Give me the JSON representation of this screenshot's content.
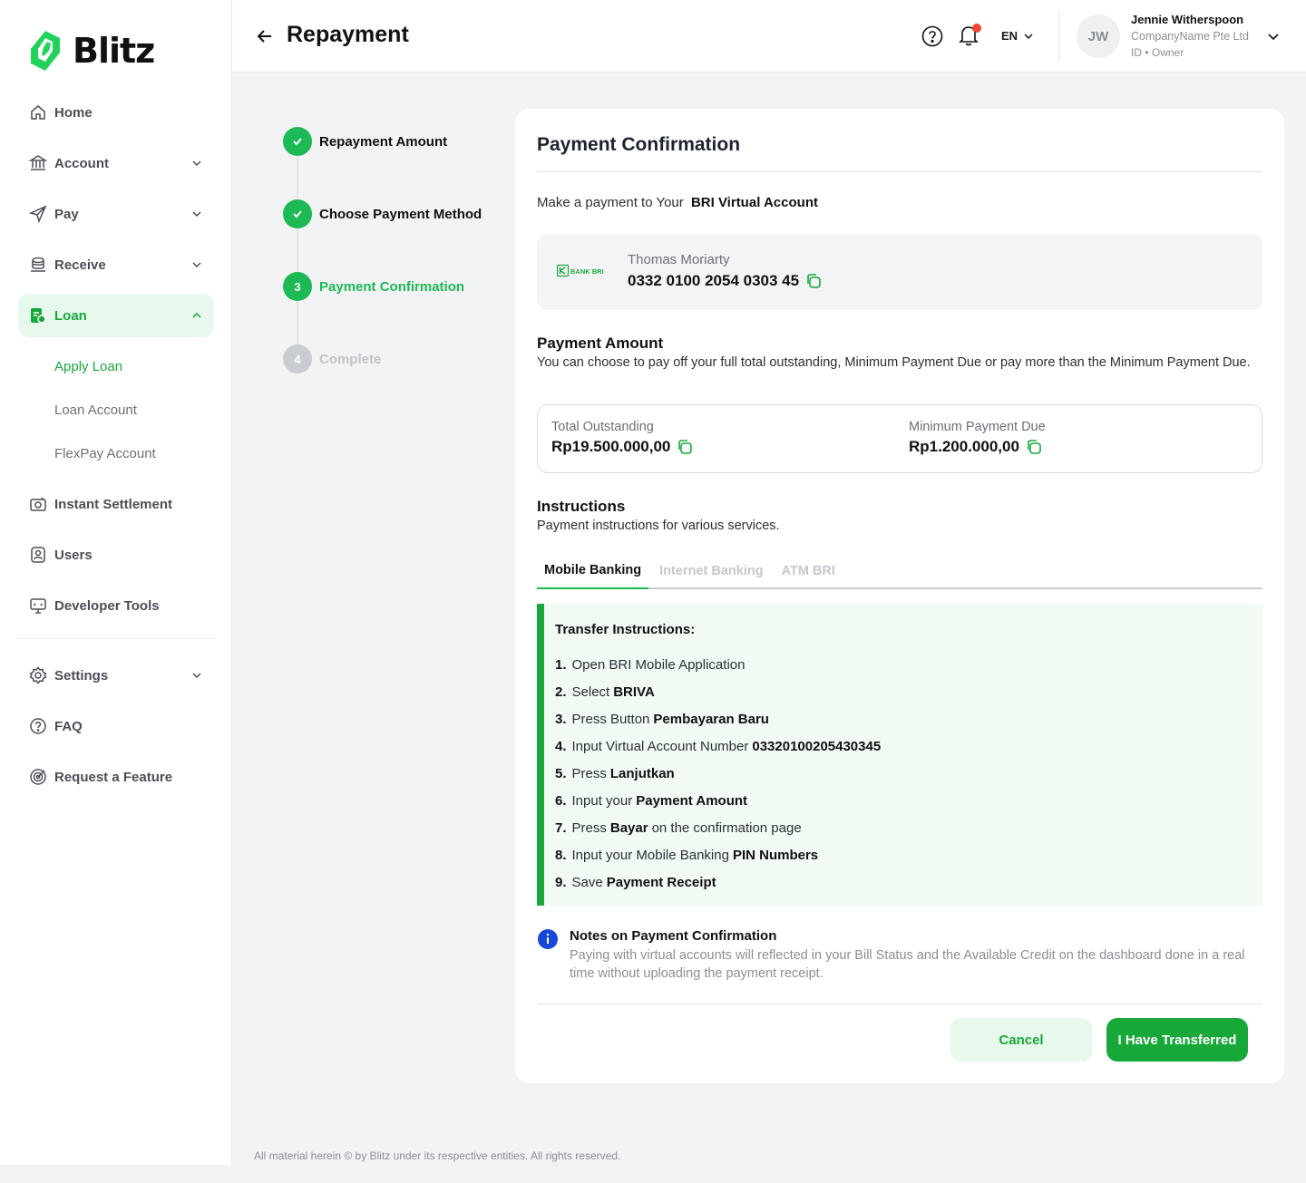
{
  "brand": {
    "name": "Blitz",
    "accent": "#18A83A"
  },
  "sidebar": {
    "items": [
      {
        "label": "Home",
        "icon": "home-icon"
      },
      {
        "label": "Account",
        "icon": "bank-icon"
      },
      {
        "label": "Pay",
        "icon": "send-icon"
      },
      {
        "label": "Receive",
        "icon": "coins-icon"
      },
      {
        "label": "Loan",
        "icon": "loan-icon"
      },
      {
        "label": "Instant Settlement",
        "icon": "camera-icon"
      },
      {
        "label": "Users",
        "icon": "user-badge-icon"
      },
      {
        "label": "Developer Tools",
        "icon": "monitor-icon"
      },
      {
        "label": "Settings",
        "icon": "gear-icon"
      },
      {
        "label": "FAQ",
        "icon": "question-icon"
      },
      {
        "label": "Request a Feature",
        "icon": "target-icon"
      }
    ],
    "loan_sub": [
      "Apply Loan",
      "Loan Account",
      "FlexPay Account"
    ]
  },
  "header": {
    "title": "Repayment",
    "lang": "EN",
    "user": {
      "initials": "JW",
      "name": "Jennie Witherspoon",
      "company": "CompanyName Pte Ltd",
      "role": "ID • Owner"
    }
  },
  "stepper": [
    {
      "label": "Repayment Amount",
      "state": "done",
      "number": "1"
    },
    {
      "label": "Choose Payment Method",
      "state": "done",
      "number": "2"
    },
    {
      "label": "Payment Confirmation",
      "state": "current",
      "number": "3"
    },
    {
      "label": "Complete",
      "state": "todo",
      "number": "4"
    }
  ],
  "confirmation": {
    "title": "Payment Confirmation",
    "make_payment_prefix": "Make a payment to Your",
    "make_payment_target": "BRI Virtual Account",
    "bank_logo_text": "BANK BRI",
    "account_name": "Thomas Moriarty",
    "account_number": "0332 0100 2054 0303 45",
    "amount_title": "Payment Amount",
    "amount_desc": "You can choose to pay off your full total outstanding, Minimum Payment Due or pay more than the Minimum Payment Due.",
    "total_label": "Total Outstanding",
    "total_value": "Rp19.500.000,00",
    "min_label": "Minimum Payment Due",
    "min_value": "Rp1.200.000,00",
    "instructions_title": "Instructions",
    "instructions_desc": "Payment instructions for various services.",
    "tabs": [
      "Mobile Banking",
      "Internet Banking",
      "ATM BRI"
    ],
    "transfer_title": "Transfer Instructions:",
    "steps": [
      {
        "n": "1.",
        "pre": "Open BRI Mobile Application",
        "bold": "",
        "post": ""
      },
      {
        "n": "2.",
        "pre": "Select",
        "bold": "BRIVA",
        "post": ""
      },
      {
        "n": "3.",
        "pre": "Press Button",
        "bold": "Pembayaran Baru",
        "post": ""
      },
      {
        "n": "4.",
        "pre": "Input Virtual Account Number",
        "bold": "03320100205430345",
        "post": ""
      },
      {
        "n": "5.",
        "pre": "Press",
        "bold": "Lanjutkan",
        "post": ""
      },
      {
        "n": "6.",
        "pre": "Input your",
        "bold": "Payment Amount",
        "post": ""
      },
      {
        "n": "7.",
        "pre": "Press",
        "bold": "Bayar",
        "post": "on the confirmation page"
      },
      {
        "n": "8.",
        "pre": "Input your Mobile Banking",
        "bold": "PIN Numbers",
        "post": ""
      },
      {
        "n": "9.",
        "pre": "Save",
        "bold": "Payment Receipt",
        "post": ""
      }
    ],
    "notes_title": "Notes on Payment Confirmation",
    "notes_desc": "Paying with virtual accounts will reflected in your Bill Status and the Available Credit on the dashboard done in a real time without uploading the payment receipt.",
    "cancel_label": "Cancel",
    "confirm_label": "I Have Transferred"
  },
  "footer": "All material herein © by Blitz under its respective entities. All rights reserved."
}
